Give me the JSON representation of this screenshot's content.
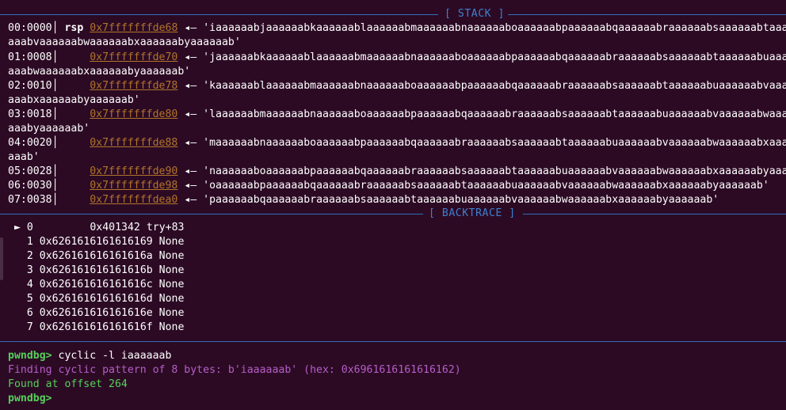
{
  "stack_header": "[ STACK ]",
  "backtrace_header": "[ BACKTRACE ]",
  "stack": [
    {
      "offset": "00:0000",
      "register": "rsp",
      "address": "0x7fffffffde68",
      "arrow": "◂—",
      "value": "'iaaaaaabjaaaaaabkaaaaaablaaaaaabmaaaaaabnaaaaaaboaaaaaabpaaaaaabqaaaaaabraaaaaabsaaaaaabtaaaaaabuaaaa",
      "wrap": "aaabvaaaaaabwaaaaaabxaaaaaabyaaaaaab'"
    },
    {
      "offset": "01:0008",
      "register": "",
      "address": "0x7fffffffde70",
      "arrow": "◂—",
      "value": "'jaaaaaabkaaaaaablaaaaaabmaaaaaabnaaaaaaboaaaaaabpaaaaaabqaaaaaabraaaaaabsaaaaaabtaaaaaabuaaaaaabvaaaa",
      "wrap": "aaabwaaaaaabxaaaaaabyaaaaaab'"
    },
    {
      "offset": "02:0010",
      "register": "",
      "address": "0x7fffffffde78",
      "arrow": "◂—",
      "value": "'kaaaaaablaaaaaabmaaaaaabnaaaaaaboaaaaaabpaaaaaabqaaaaaabraaaaaabsaaaaaabtaaaaaabuaaaaaabvaaaaaabwaaaa",
      "wrap": "aaabxaaaaaabyaaaaaab'"
    },
    {
      "offset": "03:0018",
      "register": "",
      "address": "0x7fffffffde80",
      "arrow": "◂—",
      "value": "'laaaaaabmaaaaaabnaaaaaaboaaaaaabpaaaaaabqaaaaaabraaaaaabsaaaaaabtaaaaaabuaaaaaabvaaaaaabwaaaaaabxaaaa",
      "wrap": "aaabyaaaaaab'"
    },
    {
      "offset": "04:0020",
      "register": "",
      "address": "0x7fffffffde88",
      "arrow": "◂—",
      "value": "'maaaaaabnaaaaaaboaaaaaabpaaaaaabqaaaaaabraaaaaabsaaaaaabtaaaaaabuaaaaaabvaaaaaabwaaaaaabxaaaaaabyaaaa",
      "wrap": "aaab'"
    },
    {
      "offset": "05:0028",
      "register": "",
      "address": "0x7fffffffde90",
      "arrow": "◂—",
      "value": "'naaaaaaboaaaaaabpaaaaaabqaaaaaabraaaaaabsaaaaaabtaaaaaabuaaaaaabvaaaaaabwaaaaaabxaaaaaabyaaaaaab'",
      "wrap": ""
    },
    {
      "offset": "06:0030",
      "register": "",
      "address": "0x7fffffffde98",
      "arrow": "◂—",
      "value": "'oaaaaaabpaaaaaabqaaaaaabraaaaaabsaaaaaabtaaaaaabuaaaaaabvaaaaaabwaaaaaabxaaaaaabyaaaaaab'",
      "wrap": ""
    },
    {
      "offset": "07:0038",
      "register": "",
      "address": "0x7fffffffdea0",
      "arrow": "◂—",
      "value": "'paaaaaabqaaaaaabraaaaaabsaaaaaabtaaaaaabuaaaaaabvaaaaaabwaaaaaabxaaaaaabyaaaaaab'",
      "wrap": ""
    }
  ],
  "backtrace": [
    {
      "marker": "►",
      "index": "0",
      "address": "        0x401342",
      "symbol": "try+83"
    },
    {
      "marker": "",
      "index": "1",
      "address": "0x6261616161616169",
      "symbol": "None"
    },
    {
      "marker": "",
      "index": "2",
      "address": "0x626161616161616a",
      "symbol": "None"
    },
    {
      "marker": "",
      "index": "3",
      "address": "0x626161616161616b",
      "symbol": "None"
    },
    {
      "marker": "",
      "index": "4",
      "address": "0x626161616161616c",
      "symbol": "None"
    },
    {
      "marker": "",
      "index": "5",
      "address": "0x626161616161616d",
      "symbol": "None"
    },
    {
      "marker": "",
      "index": "6",
      "address": "0x626161616161616e",
      "symbol": "None"
    },
    {
      "marker": "",
      "index": "7",
      "address": "0x626161616161616f",
      "symbol": "None"
    }
  ],
  "console": {
    "prompt": "pwndbg>",
    "command": " cyclic -l iaaaaaab",
    "finding": "Finding cyclic pattern of 8 bytes: b'iaaaaaab' (hex: 0x6961616161616162)",
    "found": "Found at offset 264",
    "prompt2": "pwndbg>"
  },
  "colors": {
    "background": "#2c0a24",
    "address": "#b0742a",
    "header": "#3f7fd0",
    "prompt": "#55d05a",
    "purple": "#b65ec7"
  }
}
